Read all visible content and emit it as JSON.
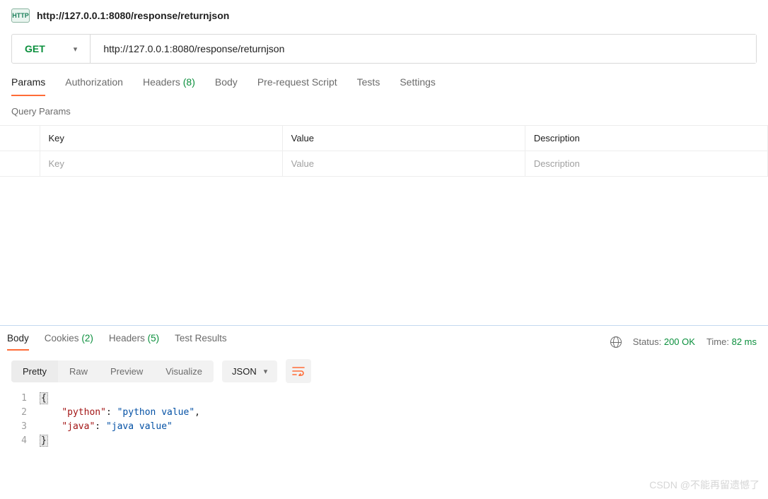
{
  "header": {
    "title": "http://127.0.0.1:8080/response/returnjson"
  },
  "request": {
    "method": "GET",
    "url": "http://127.0.0.1:8080/response/returnjson"
  },
  "tabs": {
    "params": "Params",
    "authorization": "Authorization",
    "headers_label": "Headers",
    "headers_count": "(8)",
    "body": "Body",
    "prerequest": "Pre-request Script",
    "tests": "Tests",
    "settings": "Settings"
  },
  "query_params": {
    "title": "Query Params",
    "columns": {
      "key": "Key",
      "value": "Value",
      "description": "Description"
    },
    "placeholders": {
      "key": "Key",
      "value": "Value",
      "description": "Description"
    }
  },
  "response_tabs": {
    "body": "Body",
    "cookies_label": "Cookies",
    "cookies_count": "(2)",
    "headers_label": "Headers",
    "headers_count": "(5)",
    "test_results": "Test Results"
  },
  "response_meta": {
    "status_label": "Status:",
    "status_value": "200 OK",
    "time_label": "Time:",
    "time_value": "82 ms"
  },
  "view_modes": {
    "pretty": "Pretty",
    "raw": "Raw",
    "preview": "Preview",
    "visualize": "Visualize",
    "format": "JSON"
  },
  "response_body": {
    "lines": [
      "1",
      "2",
      "3",
      "4"
    ],
    "l1_open": "{",
    "l2_key": "\"python\"",
    "l2_val": "\"python value\"",
    "l2_colon": ": ",
    "l2_comma": ",",
    "l3_key": "\"java\"",
    "l3_val": "\"java value\"",
    "l3_colon": ": ",
    "l4_close": "}"
  },
  "watermark": "CSDN @不能再留遗憾了"
}
